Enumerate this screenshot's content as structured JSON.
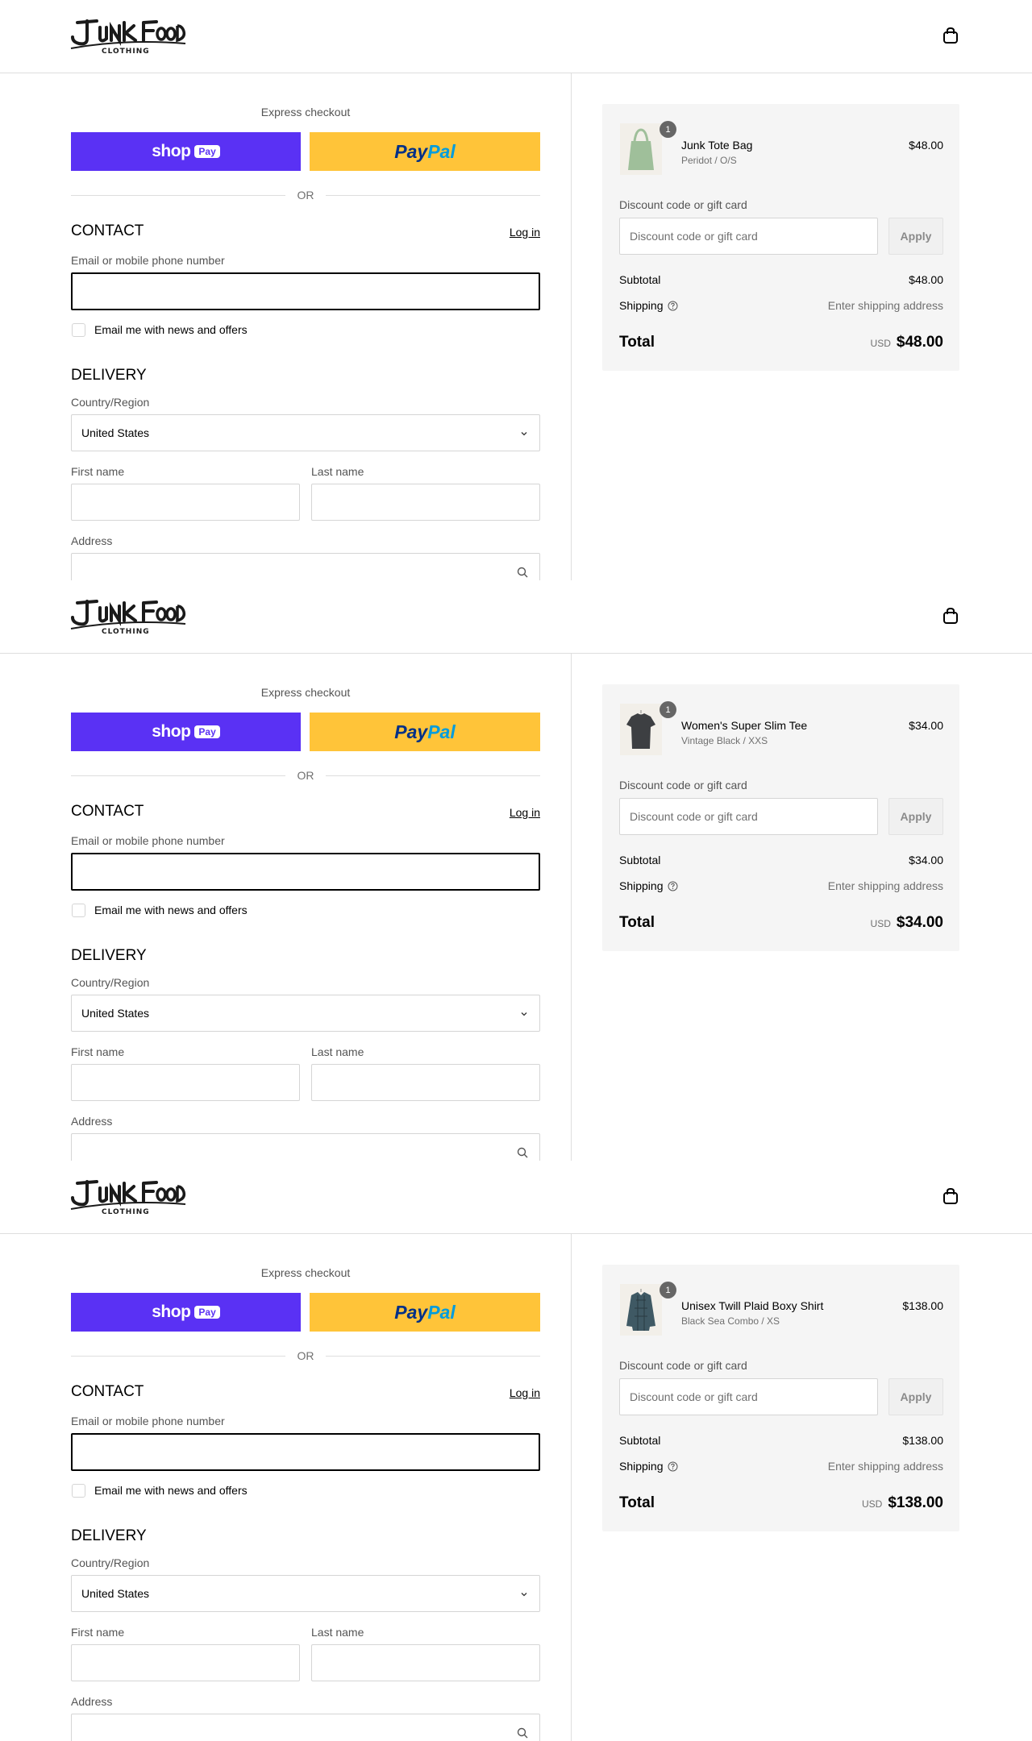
{
  "header": {
    "logo_text": "Junk Food Clothing",
    "cart_icon": "shopping-bag-icon"
  },
  "express": {
    "label": "Express checkout",
    "shop_pay_word": "shop",
    "shop_pay_pill": "Pay",
    "paypal_part1": "Pay",
    "paypal_part2": "Pal",
    "or_text": "OR",
    "shop_pay_color": "#5a31f4",
    "paypal_color": "#ffc439"
  },
  "contact": {
    "title": "CONTACT",
    "login_link": "Log in",
    "email_label": "Email or mobile phone number",
    "email_value": "",
    "newsletter_label": "Email me with news and offers",
    "newsletter_checked": false
  },
  "delivery": {
    "title": "DELIVERY",
    "country_label": "Country/Region",
    "country_value": "United States",
    "first_name_label": "First name",
    "last_name_label": "Last name",
    "address_label": "Address"
  },
  "summary_labels": {
    "discount_label": "Discount code or gift card",
    "discount_placeholder": "Discount code or gift card",
    "apply": "Apply",
    "subtotal": "Subtotal",
    "shipping": "Shipping",
    "shipping_value": "Enter shipping address",
    "total": "Total",
    "currency": "USD"
  },
  "carts": [
    {
      "qty": "1",
      "product": "Junk Tote Bag",
      "variant": "Peridot / O/S",
      "price": "$48.00",
      "subtotal": "$48.00",
      "total": "$48.00",
      "thumb_color": "#9fbf9a",
      "thumb_type": "tote"
    },
    {
      "qty": "1",
      "product": "Women's Super Slim Tee",
      "variant": "Vintage Black / XXS",
      "price": "$34.00",
      "subtotal": "$34.00",
      "total": "$34.00",
      "thumb_color": "#3d3f42",
      "thumb_type": "tee"
    },
    {
      "qty": "1",
      "product": "Unisex Twill Plaid Boxy Shirt",
      "variant": "Black Sea Combo / XS",
      "price": "$138.00",
      "subtotal": "$138.00",
      "total": "$138.00",
      "thumb_color": "#3f5964",
      "thumb_type": "shirt"
    }
  ]
}
